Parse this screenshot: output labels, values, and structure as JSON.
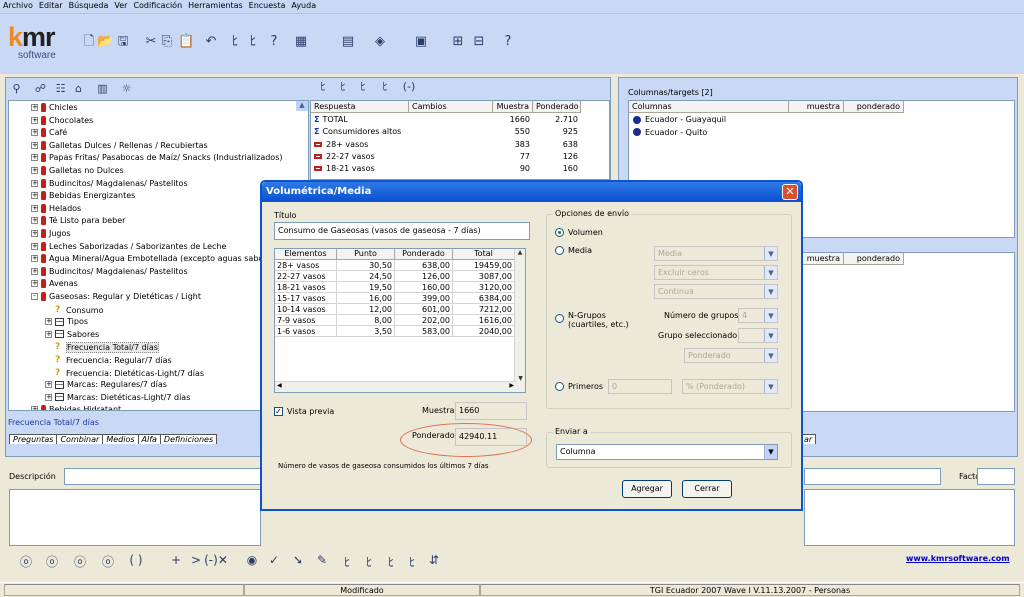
{
  "menu": [
    "Archivo",
    "Editar",
    "Búsqueda",
    "Ver",
    "Codificación",
    "Herramientas",
    "Encuesta",
    "Ayuda"
  ],
  "logo": {
    "main": "kmr",
    "sub": "software"
  },
  "tree": {
    "items": [
      {
        "label": "Chicles",
        "type": "bottle",
        "pm": "+"
      },
      {
        "label": "Chocolates",
        "type": "bottle",
        "pm": "+"
      },
      {
        "label": "Café",
        "type": "bottle",
        "pm": "+"
      },
      {
        "label": "Galletas Dulces / Rellenas / Recubiertas",
        "type": "bottle",
        "pm": "+"
      },
      {
        "label": "Papas Fritas/ Pasabocas de Maíz/ Snacks (Industrializados)",
        "type": "bottle",
        "pm": "+"
      },
      {
        "label": "Galletas no Dulces",
        "type": "bottle",
        "pm": "+"
      },
      {
        "label": "Budincitos/ Magdalenas/ Pastelitos",
        "type": "bottle",
        "pm": "+"
      },
      {
        "label": "Bebidas Energizantes",
        "type": "bottle",
        "pm": "+"
      },
      {
        "label": "Helados",
        "type": "bottle",
        "pm": "+"
      },
      {
        "label": "Té Listo para beber",
        "type": "bottle",
        "pm": "+"
      },
      {
        "label": "Jugos",
        "type": "bottle",
        "pm": "+"
      },
      {
        "label": "Leches Saborizadas / Saborizantes de Leche",
        "type": "bottle",
        "pm": "+"
      },
      {
        "label": "Agua Mineral/Agua Embotellada (excepto aguas sabo",
        "type": "bottle",
        "pm": "+"
      },
      {
        "label": "Budincitos/ Magdalenas/ Pastelitos",
        "type": "bottle",
        "pm": "+"
      },
      {
        "label": "Avenas",
        "type": "bottle",
        "pm": "+"
      },
      {
        "label": "Gaseosas: Regular y Dietéticas / Light",
        "type": "bottle",
        "pm": "-"
      },
      {
        "label": "Consumo",
        "type": "q",
        "pm": "",
        "indent": 1
      },
      {
        "label": "Tipos",
        "type": "tbl",
        "pm": "+",
        "indent": 1
      },
      {
        "label": "Sabores",
        "type": "tbl",
        "pm": "+",
        "indent": 1
      },
      {
        "label": "Frecuencia Total/7 días",
        "type": "q",
        "pm": "",
        "indent": 1,
        "selected": true
      },
      {
        "label": "Frecuencia: Regular/7 días",
        "type": "q",
        "pm": "",
        "indent": 1
      },
      {
        "label": "Frecuencia: Dietéticas-Light/7 días",
        "type": "q",
        "pm": "",
        "indent": 1
      },
      {
        "label": "Marcas: Regulares/7 días",
        "type": "tbl",
        "pm": "+",
        "indent": 1
      },
      {
        "label": "Marcas: Dietéticas-Light/7 días",
        "type": "tbl",
        "pm": "+",
        "indent": 1
      },
      {
        "label": "Bebidas Hidratant...",
        "type": "bottle",
        "pm": "+"
      }
    ],
    "selected_caption": "Frecuencia Total/7 días"
  },
  "bottom_tabs": [
    "Preguntas",
    "Combinar",
    "Medios",
    "Alfa",
    "Definiciones"
  ],
  "responses": {
    "headers": [
      "Respuesta",
      "Cambios",
      "Muestra",
      "Ponderado"
    ],
    "rows": [
      {
        "label": "TOTAL",
        "muestra": "1660",
        "ponderado": "2.710",
        "icon": "sigma"
      },
      {
        "label": "Consumidores altos",
        "muestra": "550",
        "ponderado": "925",
        "icon": "sigma"
      },
      {
        "label": "28+ vasos",
        "muestra": "383",
        "ponderado": "638",
        "icon": "rect"
      },
      {
        "label": "22-27 vasos",
        "muestra": "77",
        "ponderado": "126",
        "icon": "rect"
      },
      {
        "label": "18-21 vasos",
        "muestra": "90",
        "ponderado": "160",
        "icon": "rect"
      }
    ]
  },
  "targets": {
    "title": "Columnas/targets [2]",
    "headers": [
      "Columnas",
      "muestra",
      "ponderado"
    ],
    "rows": [
      "Ecuador - Guayaquil",
      "Ecuador - Quito"
    ],
    "headers2": [
      "muestra",
      "ponderado"
    ]
  },
  "right_tab": "ar",
  "descripcion_label": "Descripción",
  "factor_label": "Factor",
  "website": "www.kmrsoftware.com",
  "status": {
    "mod": "Modificado",
    "info": "TGI Ecuador 2007 Wave I V.11.13.2007 - Personas"
  },
  "dialog": {
    "title": "Volumétrica/Media",
    "titulo_label": "Título",
    "titulo_value": "Consumo de Gaseosas (vasos de gaseosa - 7 días)",
    "grid_headers": [
      "Elementos",
      "Punto",
      "Ponderado",
      "Total"
    ],
    "grid_rows": [
      [
        "28+ vasos",
        "30,50",
        "638,00",
        "19459,00"
      ],
      [
        "22-27 vasos",
        "24,50",
        "126,00",
        "3087,00"
      ],
      [
        "18-21 vasos",
        "19,50",
        "160,00",
        "3120,00"
      ],
      [
        "15-17 vasos",
        "16,00",
        "399,00",
        "6384,00"
      ],
      [
        "10-14 vasos",
        "12,00",
        "601,00",
        "7212,00"
      ],
      [
        "7-9 vasos",
        "8,00",
        "202,00",
        "1616,00"
      ],
      [
        "1-6 vasos",
        "3,50",
        "583,00",
        "2040,00"
      ]
    ],
    "vista_previa": "Vista previa",
    "muestra_label": "Muestra",
    "muestra_value": "1660",
    "ponderado_label": "Ponderado",
    "ponderado_value": "42940.11",
    "note": "Número de vasos de gaseosa consumidos los últimos 7 días",
    "opciones_label": "Opciones de envío",
    "volumen": "Volumen",
    "media": "Media",
    "media_dd": "Media",
    "excluir_dd": "Excluir ceros",
    "continua_dd": "Continua",
    "ngrupos": "N-Grupos (cuartiles, etc.)",
    "num_grupos_label": "Número de grupos",
    "num_grupos_value": "4",
    "grupo_sel_label": "Grupo seleccionado",
    "grupo_pond_dd": "Ponderado",
    "primeros": "Primeros",
    "primeros_value": "0",
    "pct_dd": "% (Ponderado)",
    "enviar_label": "Enviar a",
    "enviar_value": "Columna",
    "agregar": "Agregar",
    "cerrar": "Cerrar"
  },
  "colors": {
    "accent": "#0A54D0",
    "logo_orange": "#F08A1A",
    "link": "#0000CC",
    "highlight": "#E07050"
  }
}
